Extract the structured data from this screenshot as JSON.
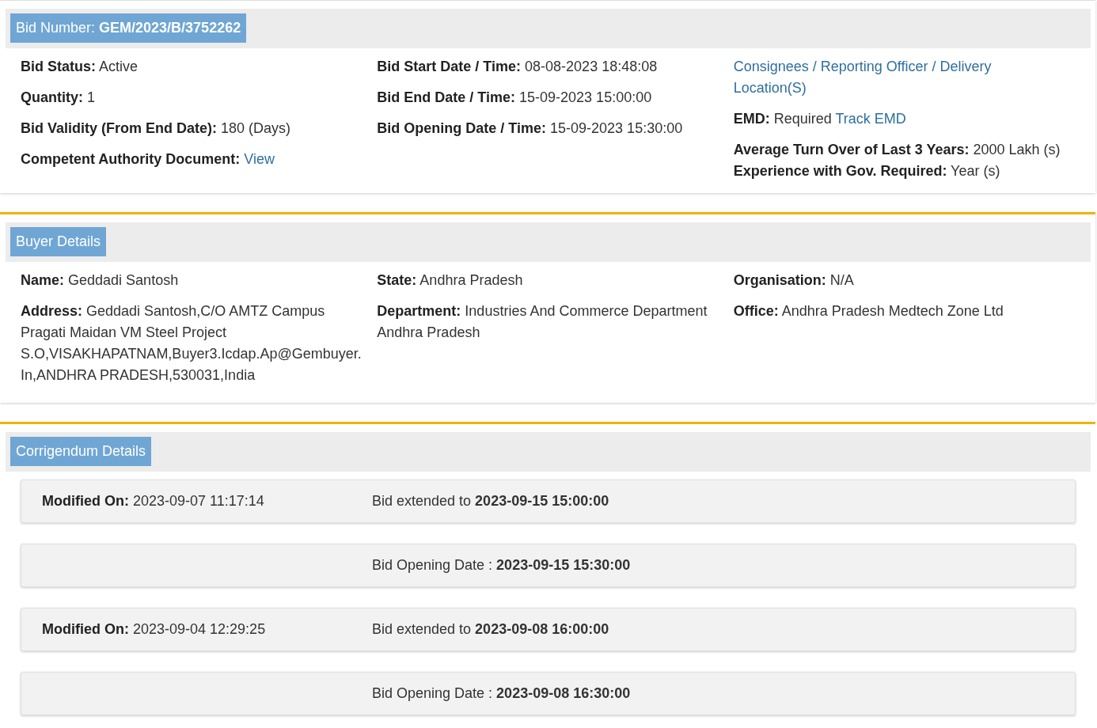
{
  "bid_panel": {
    "header": "Bid Number: **GEM/2023/B/3752262**",
    "columns": [
      [
        {
          "lines": [
            [
              {
                "kind": "label",
                "text": "Bid Status:"
              },
              {
                "kind": "text",
                "text": "Active"
              }
            ]
          ]
        },
        {
          "lines": [
            [
              {
                "kind": "label",
                "text": "Quantity:"
              },
              {
                "kind": "text",
                "text": "1"
              }
            ]
          ]
        },
        {
          "lines": [
            [
              {
                "kind": "label",
                "text": "Bid Validity (From End Date):"
              },
              {
                "kind": "text",
                "text": "180 (Days)"
              }
            ]
          ]
        },
        {
          "lines": [
            [
              {
                "kind": "label",
                "text": "Competent Authority Document:"
              },
              {
                "kind": "link",
                "text": "View"
              }
            ]
          ]
        }
      ],
      [
        {
          "lines": [
            [
              {
                "kind": "label",
                "text": "Bid Start Date / Time:"
              },
              {
                "kind": "text",
                "text": "08-08-2023 18:48:08"
              }
            ]
          ]
        },
        {
          "lines": [
            [
              {
                "kind": "label",
                "text": "Bid End Date / Time:"
              },
              {
                "kind": "text",
                "text": "15-09-2023 15:00:00"
              }
            ]
          ]
        },
        {
          "lines": [
            [
              {
                "kind": "label",
                "text": "Bid Opening Date / Time:"
              },
              {
                "kind": "text",
                "text": "15-09-2023 15:30:00"
              }
            ]
          ]
        }
      ],
      [
        {
          "lines": [
            [
              {
                "kind": "link",
                "text": "Consignees / Reporting Officer / Delivery Location(S)"
              }
            ]
          ]
        },
        {
          "lines": [
            [
              {
                "kind": "label",
                "text": "EMD:"
              },
              {
                "kind": "text",
                "text": "Required"
              },
              {
                "kind": "link",
                "text": "Track EMD"
              }
            ]
          ]
        },
        {
          "lines": [
            [
              {
                "kind": "label",
                "text": "Average Turn Over of Last 3 Years:"
              },
              {
                "kind": "text",
                "text": "2000 Lakh (s)"
              }
            ],
            [
              {
                "kind": "label",
                "text": "Experience with Gov. Required:"
              },
              {
                "kind": "text",
                "text": "Year (s)"
              }
            ]
          ]
        }
      ]
    ]
  },
  "buyer_panel": {
    "header": "Buyer Details",
    "columns": [
      [
        {
          "lines": [
            [
              {
                "kind": "label",
                "text": "Name:"
              },
              {
                "kind": "text",
                "text": "Geddadi Santosh"
              }
            ]
          ]
        },
        {
          "lines": [
            [
              {
                "kind": "label",
                "text": "Address:"
              },
              {
                "kind": "text",
                "text": "Geddadi Santosh,C/O AMTZ Campus Pragati Maidan VM Steel Project S.O,VISAKHAPATNAM,Buyer3.Icdap.Ap@Gembuyer.In,ANDHRA PRADESH,530031,India"
              }
            ]
          ]
        }
      ],
      [
        {
          "lines": [
            [
              {
                "kind": "label",
                "text": "State:"
              },
              {
                "kind": "text",
                "text": "Andhra Pradesh"
              }
            ]
          ]
        },
        {
          "lines": [
            [
              {
                "kind": "label",
                "text": "Department:"
              },
              {
                "kind": "text",
                "text": "Industries And Commerce Department Andhra Pradesh"
              }
            ]
          ]
        }
      ],
      [
        {
          "lines": [
            [
              {
                "kind": "label",
                "text": "Organisation:"
              },
              {
                "kind": "text",
                "text": "N/A"
              }
            ]
          ]
        },
        {
          "lines": [
            [
              {
                "kind": "label",
                "text": "Office:"
              },
              {
                "kind": "text",
                "text": "Andhra Pradesh Medtech Zone Ltd"
              }
            ]
          ]
        }
      ]
    ]
  },
  "corrigendum_panel": {
    "header": "Corrigendum Details",
    "rows": [
      {
        "modified_label": "Modified On:",
        "modified_value": "2023-09-07 11:17:14",
        "description": "Bid extended to **2023-09-15 15:00:00**"
      },
      {
        "description": "Bid Opening Date : **2023-09-15 15:30:00**"
      },
      {
        "modified_label": "Modified On:",
        "modified_value": "2023-09-04 12:29:25",
        "description": "Bid extended to **2023-09-08 16:00:00**"
      },
      {
        "description": "Bid Opening Date : **2023-09-08 16:30:00**"
      }
    ]
  }
}
